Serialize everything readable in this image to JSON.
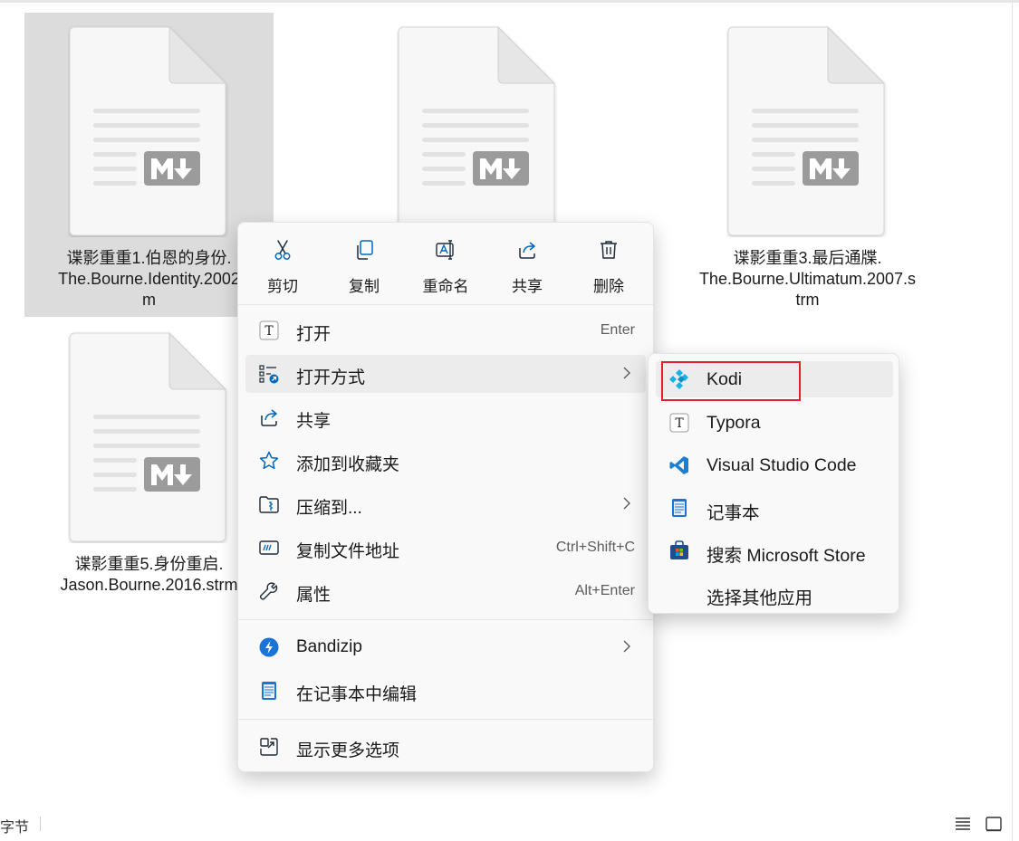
{
  "files": [
    {
      "name": "谍影重重1.伯恩的身份.\nThe.Bourne.Identity.2002\nm",
      "selected": true,
      "icon": "markdown-file-icon"
    },
    {
      "name": "",
      "selected": false,
      "icon": "markdown-file-icon"
    },
    {
      "name": "谍影重重3.最后通牒.\nThe.Bourne.Ultimatum.2007.s\ntrm",
      "selected": false,
      "icon": "markdown-file-icon"
    },
    {
      "name": "谍影重重5.身份重启.\nJason.Bourne.2016.strm",
      "selected": false,
      "icon": "markdown-file-icon"
    }
  ],
  "status_bar": {
    "left_text": "字节"
  },
  "context_menu": {
    "quick_actions": [
      {
        "label": "剪切",
        "icon": "scissors-icon"
      },
      {
        "label": "复制",
        "icon": "copy-icon"
      },
      {
        "label": "重命名",
        "icon": "rename-icon"
      },
      {
        "label": "共享",
        "icon": "share-icon"
      },
      {
        "label": "删除",
        "icon": "trash-icon"
      }
    ],
    "items": [
      {
        "label": "打开",
        "shortcut": "Enter",
        "icon": "typora-icon"
      },
      {
        "label": "打开方式",
        "shortcut": "",
        "icon": "open-with-icon",
        "submenu": true,
        "hovered": true
      },
      {
        "label": "共享",
        "shortcut": "",
        "icon": "share-icon"
      },
      {
        "label": "添加到收藏夹",
        "shortcut": "",
        "icon": "star-icon"
      },
      {
        "label": "压缩到...",
        "shortcut": "",
        "icon": "zip-folder-icon",
        "submenu": true
      },
      {
        "label": "复制文件地址",
        "shortcut": "Ctrl+Shift+C",
        "icon": "copy-path-icon"
      },
      {
        "label": "属性",
        "shortcut": "Alt+Enter",
        "icon": "wrench-icon"
      },
      {
        "label": "Bandizip",
        "shortcut": "",
        "icon": "bandizip-icon",
        "submenu": true
      },
      {
        "label": "在记事本中编辑",
        "shortcut": "",
        "icon": "notepad-icon"
      },
      {
        "label": "显示更多选项",
        "shortcut": "",
        "icon": "show-more-icon"
      }
    ]
  },
  "open_with_submenu": {
    "items": [
      {
        "label": "Kodi",
        "icon": "kodi-icon",
        "highlighted": true
      },
      {
        "label": "Typora",
        "icon": "typora-icon"
      },
      {
        "label": "Visual Studio Code",
        "icon": "vscode-icon"
      },
      {
        "label": "记事本",
        "icon": "notepad-icon"
      },
      {
        "label": "搜索 Microsoft Store",
        "icon": "microsoft-store-icon"
      },
      {
        "label": "选择其他应用",
        "icon": ""
      }
    ]
  },
  "colors": {
    "accent": "#0067c0",
    "highlight_box": "#e0202a",
    "selection": "#dcdcdc"
  }
}
